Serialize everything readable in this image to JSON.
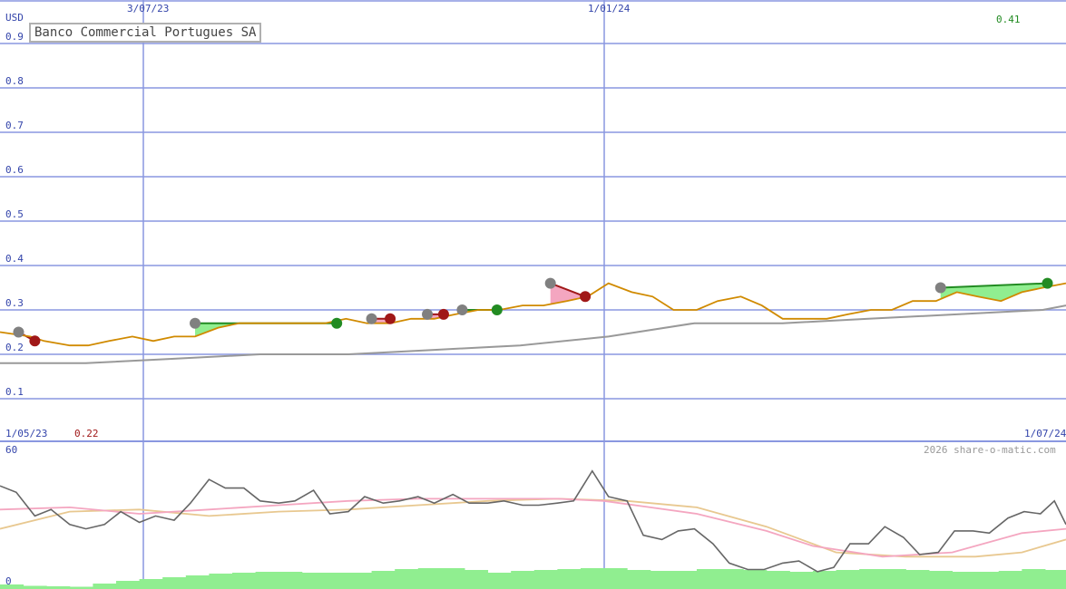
{
  "title": "Banco Commercial Portugues SA",
  "currency_label": "USD",
  "last_price_label": "0.41",
  "low_price_label": "0.22",
  "watermark": "2026 share-o-matic.com",
  "date_top": [
    "3/07/23",
    "1/01/24"
  ],
  "date_bottom": [
    "1/05/23",
    "1/07/24"
  ],
  "osc_labels": [
    "60",
    "0"
  ],
  "colors": {
    "grid": "#8a97e0",
    "price": "#d08a00",
    "average": "#999999",
    "buy_marker": "#228b22",
    "sell_marker": "#a01818",
    "neutral_marker": "#808080",
    "gain_fill": "#90ee90",
    "loss_fill": "#f4a6c0",
    "oscillator": "#666666",
    "osc_fast": "#f4a6c0",
    "osc_slow": "#e8c890",
    "volume": "#90ee90"
  },
  "chart_data": [
    {
      "type": "line",
      "y_unit": "USD",
      "ylim": [
        0.05,
        1.0
      ],
      "y_ticks": [
        0.9,
        0.8,
        0.7,
        0.6,
        0.5,
        0.4,
        0.3,
        0.2,
        0.1
      ],
      "x_range": [
        "1/05/23",
        "1/07/24"
      ],
      "series": [
        {
          "key": "price",
          "x": [
            0,
            13,
            19,
            30,
            38,
            47,
            57,
            66,
            75,
            84,
            94,
            103,
            113,
            122,
            131,
            140,
            149,
            158,
            168,
            177,
            187,
            196,
            206,
            215,
            225,
            234,
            244,
            253,
            262,
            272,
            281,
            290,
            300,
            309,
            319,
            328,
            337,
            346,
            356,
            365,
            375,
            384,
            393,
            403,
            412,
            421,
            431,
            440,
            449,
            459
          ],
          "values": [
            0.25,
            0.24,
            0.23,
            0.22,
            0.22,
            0.23,
            0.24,
            0.23,
            0.24,
            0.24,
            0.26,
            0.27,
            0.27,
            0.27,
            0.27,
            0.27,
            0.28,
            0.27,
            0.27,
            0.28,
            0.28,
            0.29,
            0.3,
            0.3,
            0.31,
            0.31,
            0.32,
            0.33,
            0.36,
            0.34,
            0.33,
            0.3,
            0.3,
            0.32,
            0.33,
            0.31,
            0.28,
            0.28,
            0.28,
            0.29,
            0.3,
            0.3,
            0.32,
            0.32,
            0.34,
            0.33,
            0.32,
            0.34,
            0.35,
            0.36
          ]
        },
        {
          "key": "average",
          "x": [
            0,
            37,
            75,
            112,
            150,
            187,
            224,
            262,
            299,
            337,
            374,
            412,
            449,
            459
          ],
          "values": [
            0.18,
            0.18,
            0.19,
            0.2,
            0.2,
            0.21,
            0.22,
            0.24,
            0.27,
            0.27,
            0.28,
            0.29,
            0.3,
            0.31
          ]
        }
      ],
      "trades": [
        {
          "x": 8,
          "y": 0.25,
          "kind": "neutral"
        },
        {
          "x": 15,
          "y": 0.23,
          "kind": "sell"
        },
        {
          "x": 84,
          "y": 0.27,
          "kind": "neutral"
        },
        {
          "x": 145,
          "y": 0.27,
          "kind": "buy"
        },
        {
          "x": 160,
          "y": 0.28,
          "kind": "neutral"
        },
        {
          "x": 168,
          "y": 0.28,
          "kind": "sell"
        },
        {
          "x": 184,
          "y": 0.29,
          "kind": "neutral"
        },
        {
          "x": 191,
          "y": 0.29,
          "kind": "sell"
        },
        {
          "x": 199,
          "y": 0.3,
          "kind": "neutral"
        },
        {
          "x": 214,
          "y": 0.3,
          "kind": "buy"
        },
        {
          "x": 237,
          "y": 0.36,
          "kind": "neutral"
        },
        {
          "x": 252,
          "y": 0.33,
          "kind": "sell"
        },
        {
          "x": 405,
          "y": 0.35,
          "kind": "neutral"
        },
        {
          "x": 451,
          "y": 0.36,
          "kind": "buy"
        }
      ]
    },
    {
      "type": "line",
      "ylim": [
        0,
        60
      ],
      "series": [
        {
          "key": "oscillator",
          "x": [
            0,
            7,
            15,
            22,
            30,
            37,
            45,
            52,
            60,
            67,
            75,
            82,
            90,
            97,
            105,
            112,
            120,
            127,
            135,
            142,
            150,
            157,
            165,
            172,
            180,
            187,
            195,
            202,
            210,
            217,
            225,
            232,
            240,
            247,
            255,
            262,
            270,
            277,
            285,
            292,
            299,
            307,
            314,
            322,
            329,
            337,
            344,
            352,
            359,
            366,
            374,
            381,
            389,
            396,
            404,
            411,
            419,
            426,
            434,
            441,
            448,
            454,
            459
          ],
          "values": [
            43,
            40,
            29,
            32,
            25,
            23,
            25,
            31,
            26,
            29,
            27,
            35,
            46,
            42,
            42,
            36,
            35,
            36,
            41,
            30,
            31,
            38,
            35,
            36,
            38,
            35,
            39,
            35,
            35,
            36,
            34,
            34,
            35,
            36,
            50,
            38,
            36,
            20,
            18,
            22,
            23,
            16,
            7,
            4,
            4,
            7,
            8,
            3,
            5,
            16,
            16,
            24,
            19,
            11,
            12,
            22,
            22,
            21,
            28,
            31,
            30,
            36,
            25
          ]
        },
        {
          "key": "osc_fast",
          "x": [
            0,
            30,
            60,
            90,
            120,
            150,
            180,
            210,
            240,
            260,
            280,
            300,
            330,
            350,
            380,
            410,
            440,
            459
          ],
          "values": [
            32,
            33,
            30,
            32,
            34,
            36,
            37,
            37,
            37,
            36,
            33,
            30,
            22,
            15,
            10,
            12,
            21,
            23
          ]
        },
        {
          "key": "osc_slow",
          "x": [
            0,
            30,
            60,
            90,
            120,
            150,
            180,
            210,
            240,
            270,
            300,
            330,
            360,
            390,
            420,
            440,
            459
          ],
          "values": [
            23,
            31,
            32,
            29,
            31,
            32,
            34,
            36,
            37,
            36,
            33,
            24,
            12,
            10,
            10,
            12,
            18
          ]
        }
      ],
      "volume": {
        "x": [
          0,
          10,
          20,
          30,
          40,
          50,
          60,
          70,
          80,
          90,
          100,
          110,
          120,
          130,
          140,
          150,
          160,
          170,
          180,
          190,
          200,
          210,
          220,
          230,
          240,
          250,
          260,
          270,
          280,
          290,
          300,
          310,
          320,
          330,
          340,
          350,
          360,
          370,
          380,
          390,
          400,
          410,
          420,
          430,
          440,
          450,
          459
        ],
        "values": [
          1,
          0.7,
          0.6,
          0.5,
          1.2,
          1.8,
          2.2,
          2.6,
          3,
          3.4,
          3.6,
          3.8,
          3.8,
          3.6,
          3.6,
          3.6,
          4,
          4.4,
          4.6,
          4.6,
          4.2,
          3.6,
          4,
          4.2,
          4.4,
          4.6,
          4.6,
          4.2,
          4,
          4,
          4.4,
          4.4,
          4.2,
          4,
          3.8,
          4,
          4.2,
          4.4,
          4.4,
          4.2,
          4,
          3.8,
          3.8,
          4,
          4.4,
          4.2,
          4.6
        ]
      }
    }
  ]
}
